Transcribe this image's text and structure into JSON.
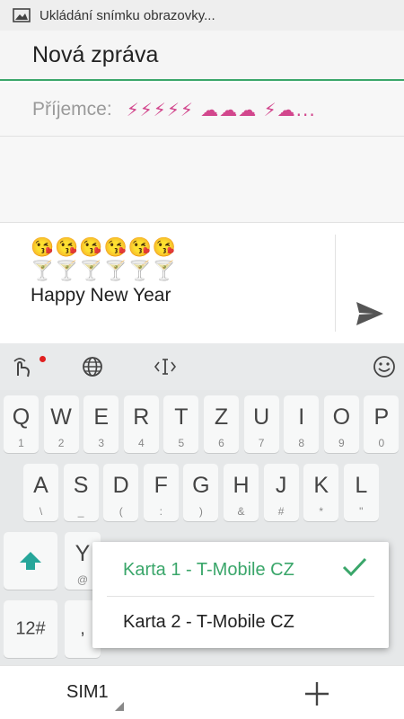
{
  "status_bar": {
    "text": "Ukládání snímku obrazovky...",
    "icon": "image-icon"
  },
  "header": {
    "title": "Nová zpráva"
  },
  "recipient": {
    "label": "Příjemce:",
    "emoji_text": "⚡⚡⚡⚡⚡ ☁☁☁ ⚡☁..."
  },
  "compose": {
    "emoji_row1": "😘😘😘😘😘😘",
    "emoji_row2": "🍸🍸🍸🍸🍸🍸",
    "message": "Happy New Year",
    "send_icon": "send-icon"
  },
  "keyboard_toolbar": {
    "icons": [
      "gesture-icon",
      "globe-icon",
      "cursor-icon",
      "smiley-icon"
    ]
  },
  "keyboard": {
    "row1": [
      {
        "main": "Q",
        "sub": "1"
      },
      {
        "main": "W",
        "sub": "2"
      },
      {
        "main": "E",
        "sub": "3"
      },
      {
        "main": "R",
        "sub": "4"
      },
      {
        "main": "T",
        "sub": "5"
      },
      {
        "main": "Z",
        "sub": "6"
      },
      {
        "main": "U",
        "sub": "7"
      },
      {
        "main": "I",
        "sub": "8"
      },
      {
        "main": "O",
        "sub": "9"
      },
      {
        "main": "P",
        "sub": "0"
      }
    ],
    "row2": [
      {
        "main": "A",
        "sub": "\\"
      },
      {
        "main": "S",
        "sub": "_"
      },
      {
        "main": "D",
        "sub": "("
      },
      {
        "main": "F",
        "sub": ":"
      },
      {
        "main": "G",
        "sub": ")"
      },
      {
        "main": "H",
        "sub": "&"
      },
      {
        "main": "J",
        "sub": "#"
      },
      {
        "main": "K",
        "sub": "*"
      },
      {
        "main": "L",
        "sub": "\""
      }
    ],
    "row3_partial": {
      "main": "Y",
      "sub": "@"
    },
    "numbers_key": "12#",
    "comma_key": ","
  },
  "sim_popup": {
    "options": [
      "Karta 1 - T-Mobile CZ",
      "Karta 2 - T-Mobile CZ"
    ],
    "selected": "Karta 1 - T-Mobile CZ",
    "accent": "#3aa66a"
  },
  "bottom_bar": {
    "sim_label": "SIM1",
    "add_icon": "plus-icon"
  }
}
